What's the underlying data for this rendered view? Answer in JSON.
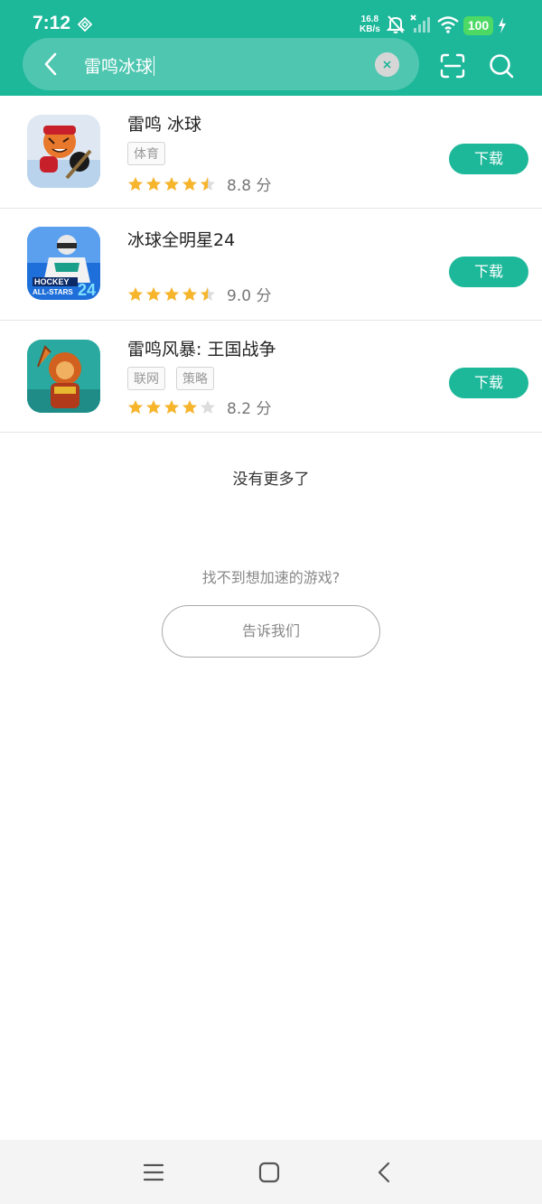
{
  "status_bar": {
    "time": "7:12",
    "net_speed_value": "16.8",
    "net_speed_unit": "KB/s",
    "battery": "100"
  },
  "search": {
    "query": "雷鸣冰球"
  },
  "results": [
    {
      "name": "雷鸣 冰球",
      "tags": [
        "体育"
      ],
      "stars": 4.5,
      "score": "8.8 分",
      "button": "下载",
      "icon": "hockey-tiger-game-icon"
    },
    {
      "name": "冰球全明星24",
      "tags": [],
      "stars": 4.5,
      "score": "9.0 分",
      "button": "下载",
      "icon": "hockey-all-stars-game-icon"
    },
    {
      "name": "雷鸣风暴: 王国战争",
      "tags": [
        "联网",
        "策略"
      ],
      "stars": 4.0,
      "score": "8.2 分",
      "button": "下载",
      "icon": "lion-warrior-game-icon"
    }
  ],
  "footer": {
    "no_more": "没有更多了",
    "cant_find": "找不到想加速的游戏?",
    "tell_us": "告诉我们"
  },
  "colors": {
    "accent": "#1db79a",
    "star": "#f7b52c",
    "star_empty": "#dddddd"
  }
}
